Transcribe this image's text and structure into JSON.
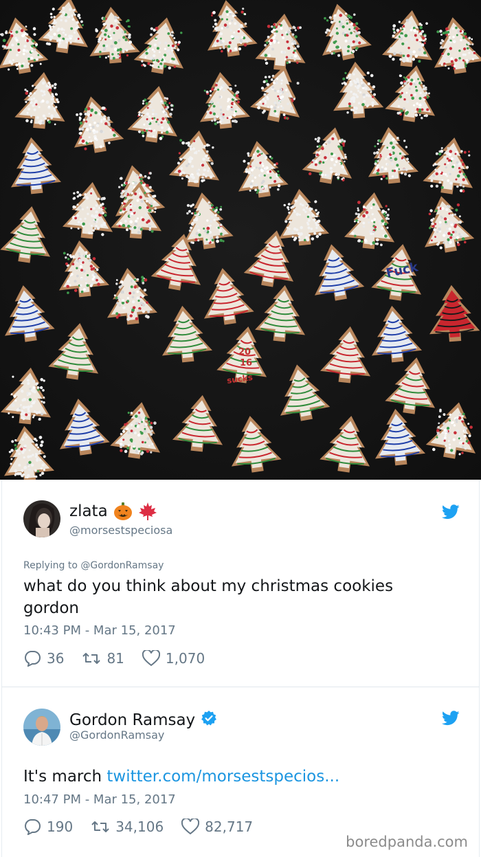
{
  "tweets": [
    {
      "display_name": "zlata",
      "name_emojis": [
        "jack-o-lantern",
        "maple-leaf"
      ],
      "handle": "@morsestspeciosa",
      "replying_prefix": "Replying to",
      "replying_to": "@GordonRamsay",
      "text": "what do you think about my christmas cookies gordon",
      "timestamp": "10:43 PM - Mar 15, 2017",
      "replies": "36",
      "retweets": "81",
      "likes": "1,070"
    },
    {
      "display_name": "Gordon Ramsay",
      "verified": true,
      "handle": "@GordonRamsay",
      "text_prefix": "It's march",
      "link": "twitter.com/morsestspecios...",
      "timestamp": "10:47 PM - Mar 15, 2017",
      "replies": "190",
      "retweets": "34,106",
      "likes": "82,717"
    }
  ],
  "watermark": "boredpanda.com",
  "photo_texts": [
    "Fuck",
    "20",
    "16",
    "sucks"
  ],
  "colors": {
    "twitter_blue": "#1da1f2",
    "link_blue": "#1b95e0",
    "muted_gray": "#657786",
    "photo_background": "#161616"
  }
}
